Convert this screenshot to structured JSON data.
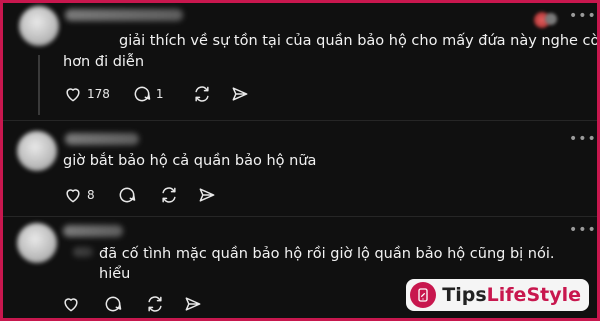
{
  "posts": [
    {
      "text_lines": [
        "giải thích về sự tồn tại của quần bảo hộ cho mấy đứa này nghe còn mệt",
        "hơn đi diễn"
      ],
      "likes": "178",
      "replies": "1",
      "more_label": "•••"
    },
    {
      "text_lines": [
        "giờ bắt bảo hộ cả quần bảo hộ nữa"
      ],
      "likes": "8",
      "more_label": "•••"
    },
    {
      "text_lines": [
        "đã cố tình mặc quần bảo hộ rồi giờ lộ quần bảo hộ cũng bị nói.",
        "hiểu"
      ],
      "more_label": "•••"
    }
  ],
  "watermark": {
    "tips": "Tips",
    "lifestyle": "LifeStyle"
  },
  "colors": {
    "border": "#c8174e",
    "background": "#101010",
    "text": "#f2f2f2"
  },
  "icons": [
    "heart-icon",
    "comment-icon",
    "repost-icon",
    "share-icon",
    "more-icon"
  ]
}
